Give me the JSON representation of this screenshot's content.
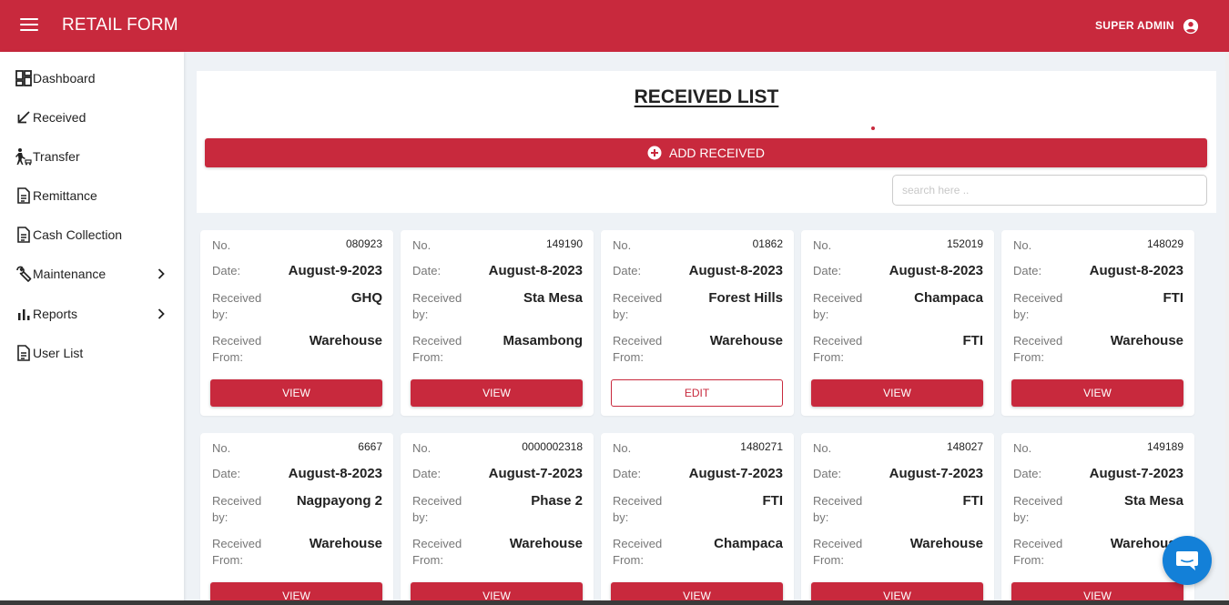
{
  "header": {
    "app_title": "RETAIL FORM",
    "user_name": "SUPER ADMIN"
  },
  "sidebar": {
    "items": [
      {
        "label": "Dashboard",
        "icon": "dashboard-icon"
      },
      {
        "label": "Received",
        "icon": "arrow-down-left-icon"
      },
      {
        "label": "Transfer",
        "icon": "person-cart-icon"
      },
      {
        "label": "Remittance",
        "icon": "document-icon"
      },
      {
        "label": "Cash Collection",
        "icon": "document-icon"
      },
      {
        "label": "Maintenance",
        "icon": "wrench-icon",
        "has_submenu": true
      },
      {
        "label": "Reports",
        "icon": "bar-chart-icon",
        "has_submenu": true
      },
      {
        "label": "User List",
        "icon": "document-icon"
      }
    ]
  },
  "main": {
    "title": "RECEIVED LIST",
    "add_button": "ADD RECEIVED",
    "search_placeholder": "search here ..",
    "search_value": "",
    "field_labels": {
      "no": "No.",
      "date": "Date:",
      "received_by_1": "Received",
      "received_by_2": "by:",
      "received_from_1": "Received",
      "received_from_2": "From:"
    },
    "cards": [
      {
        "no": "080923",
        "date": "August-9-2023",
        "received_by": "GHQ",
        "received_from": "Warehouse",
        "action": "VIEW"
      },
      {
        "no": "149190",
        "date": "August-8-2023",
        "received_by": "Sta Mesa",
        "received_from": "Masambong",
        "action": "VIEW"
      },
      {
        "no": "01862",
        "date": "August-8-2023",
        "received_by": "Forest Hills",
        "received_from": "Warehouse",
        "action": "EDIT"
      },
      {
        "no": "152019",
        "date": "August-8-2023",
        "received_by": "Champaca",
        "received_from": "FTI",
        "action": "VIEW"
      },
      {
        "no": "148029",
        "date": "August-8-2023",
        "received_by": "FTI",
        "received_from": "Warehouse",
        "action": "VIEW"
      },
      {
        "no": "6667",
        "date": "August-8-2023",
        "received_by": "Nagpayong 2",
        "received_from": "Warehouse",
        "action": "VIEW"
      },
      {
        "no": "0000002318",
        "date": "August-7-2023",
        "received_by": "Phase 2",
        "received_from": "Warehouse",
        "action": "VIEW"
      },
      {
        "no": "1480271",
        "date": "August-7-2023",
        "received_by": "FTI",
        "received_from": "Champaca",
        "action": "VIEW"
      },
      {
        "no": "148027",
        "date": "August-7-2023",
        "received_by": "FTI",
        "received_from": "Warehouse",
        "action": "VIEW"
      },
      {
        "no": "149189",
        "date": "August-7-2023",
        "received_by": "Sta Mesa",
        "received_from": "Warehouse",
        "action": "VIEW"
      }
    ]
  },
  "chat": {
    "icon": "chat-bubble-icon"
  },
  "colors": {
    "primary": "#c8293d",
    "background": "#eef2f6",
    "chat": "#1380d8"
  }
}
